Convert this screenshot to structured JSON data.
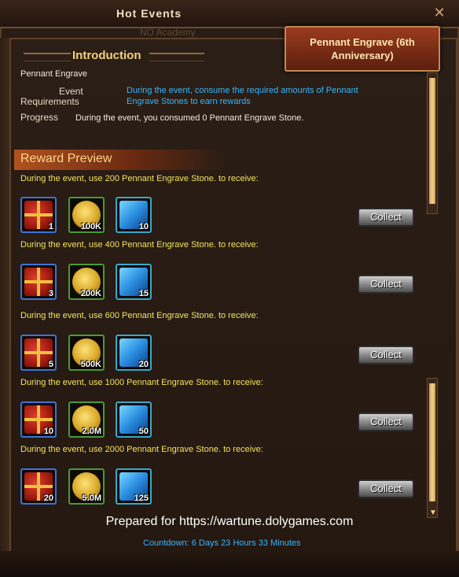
{
  "window": {
    "title": "Hot Events",
    "subtitle": "NO Academy",
    "close_icon": "close-icon"
  },
  "tab": {
    "label": "Pennant Engrave (6th Anniversary)"
  },
  "intro": {
    "heading": "Introduction",
    "event_name": "Pennant Engrave",
    "requirements_label_line1": "Event",
    "requirements_label_line2": "Requirements",
    "requirements_text": "During the event, consume the required amounts of Pennant Engrave Stones to earn rewards",
    "progress_label": "Progress",
    "progress_text": "During the event, you consumed 0 Pennant Engrave Stone."
  },
  "reward_preview": {
    "heading": "Reward Preview"
  },
  "tiers": [
    {
      "label": "During the event, use 200 Pennant Engrave Stone. to receive:",
      "items": [
        {
          "icon": "gift-box-icon",
          "qty": "1"
        },
        {
          "icon": "gold-coin-icon",
          "qty": "100K"
        },
        {
          "icon": "crystal-icon",
          "qty": "10"
        }
      ],
      "button": "Collect"
    },
    {
      "label": "During the event, use 400 Pennant Engrave Stone. to receive:",
      "items": [
        {
          "icon": "gift-box-icon",
          "qty": "3"
        },
        {
          "icon": "gold-coin-icon",
          "qty": "200K"
        },
        {
          "icon": "crystal-icon",
          "qty": "15"
        }
      ],
      "button": "Collect"
    },
    {
      "label": "During the event, use 600 Pennant Engrave Stone. to receive:",
      "items": [
        {
          "icon": "gift-box-icon",
          "qty": "5"
        },
        {
          "icon": "gold-coin-icon",
          "qty": "500K"
        },
        {
          "icon": "crystal-icon",
          "qty": "20"
        }
      ],
      "button": "Collect"
    },
    {
      "label": "During the event, use 1000 Pennant Engrave Stone. to receive:",
      "items": [
        {
          "icon": "gift-box-icon",
          "qty": "10"
        },
        {
          "icon": "gold-coin-icon",
          "qty": "2.0M"
        },
        {
          "icon": "crystal-icon",
          "qty": "50"
        }
      ],
      "button": "Collect"
    },
    {
      "label": "During the event, use 2000 Pennant Engrave Stone. to receive:",
      "items": [
        {
          "icon": "gift-box-icon",
          "qty": "20"
        },
        {
          "icon": "gold-coin-icon",
          "qty": "5.0M"
        },
        {
          "icon": "crystal-icon",
          "qty": "125"
        }
      ],
      "button": "Collect"
    }
  ],
  "watermark": "Prepared for https://wartune.dolygames.com",
  "countdown": "Countdown: 6 Days 23 Hours 33 Minutes",
  "colors": {
    "accent_blue": "#36b7ff",
    "label_yellow": "#f4e45e",
    "heading_gold": "#f5d27a"
  }
}
